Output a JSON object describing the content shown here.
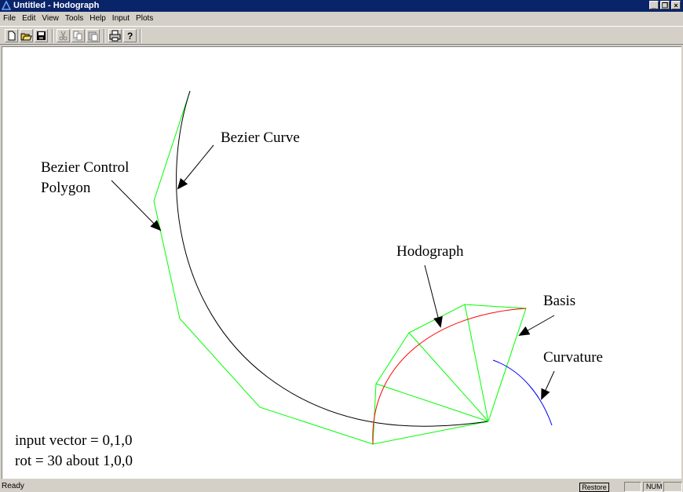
{
  "window": {
    "title": "Untitled - Hodograph"
  },
  "menu": {
    "items": [
      "File",
      "Edit",
      "View",
      "Tools",
      "Help",
      "Input",
      "Plots"
    ]
  },
  "toolbar": {
    "buttons": [
      "new-icon",
      "open-icon",
      "save-icon",
      "cut-icon",
      "copy-icon",
      "paste-icon",
      "print-icon",
      "help-icon"
    ]
  },
  "canvas": {
    "labels": {
      "bezier_curve": "Bezier Curve",
      "control_polygon_line1": "Bezier Control",
      "control_polygon_line2": "Polygon",
      "hodograph": "Hodograph",
      "basis": "Basis",
      "curvature": "Curvature",
      "input_vector": "input vector = 0,1,0",
      "rotation": "rot = 30 about 1,0,0"
    },
    "colors": {
      "control_polygon": "#00ff00",
      "bezier_curve": "#000000",
      "hodograph": "#ff0000",
      "curvature": "#0000ff"
    }
  },
  "status": {
    "text": "Ready",
    "restore": "Restore",
    "num": "NUM"
  }
}
